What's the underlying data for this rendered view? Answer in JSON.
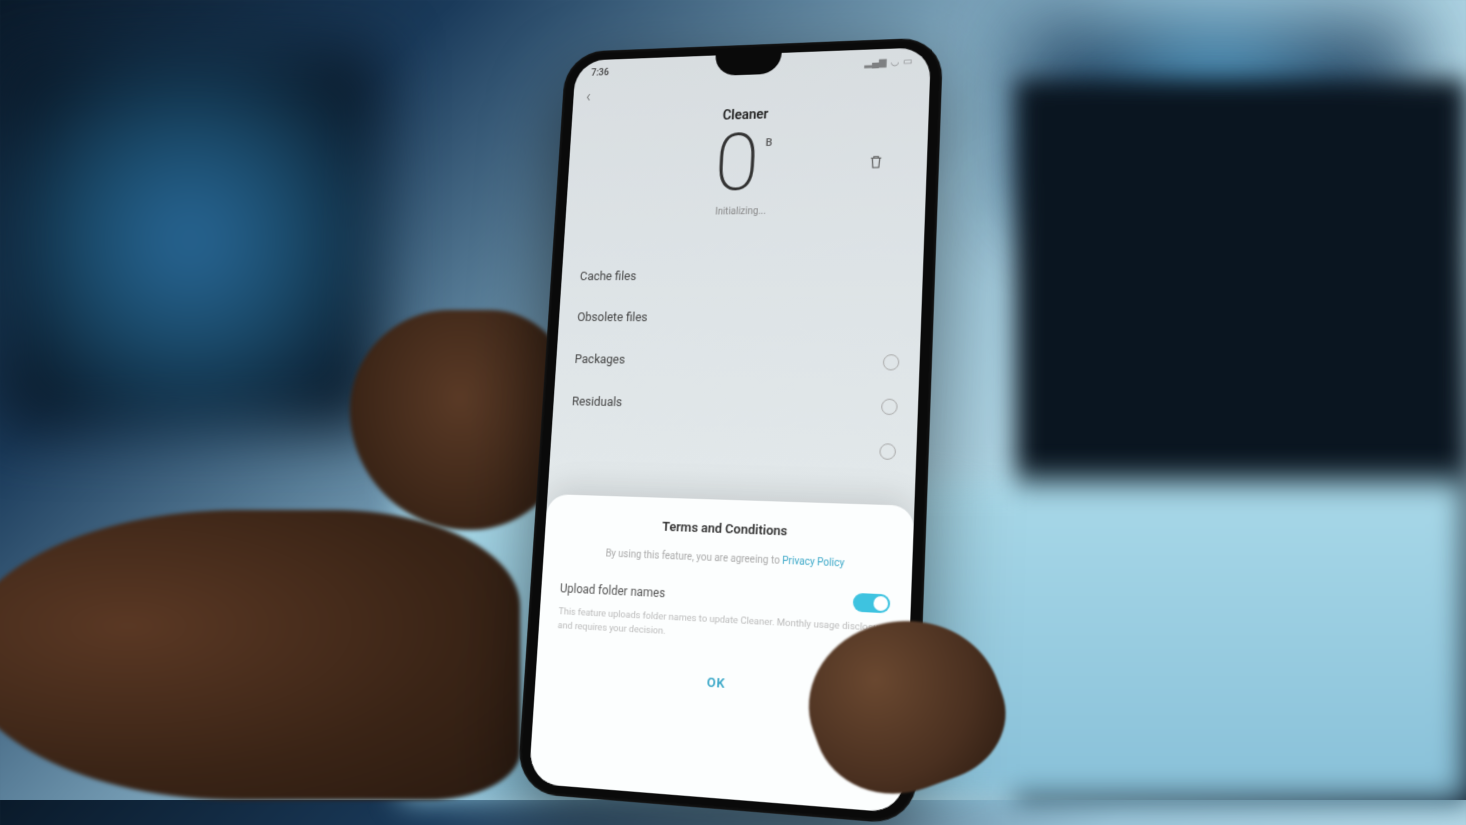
{
  "statusbar": {
    "time": "7:36"
  },
  "header": {
    "title": "Cleaner",
    "size_value": "0",
    "size_unit": "B",
    "status": "Initializing..."
  },
  "list": {
    "items": [
      {
        "label": "Cache files"
      },
      {
        "label": "Obsolete files"
      },
      {
        "label": "Packages"
      },
      {
        "label": "Residuals"
      }
    ]
  },
  "sheet": {
    "title": "Terms and Conditions",
    "subtitle_prefix": "By using this feature, you are agreeing to ",
    "subtitle_link": "Privacy Policy",
    "upload_label": "Upload folder names",
    "upload_desc": "This feature uploads folder names to update Cleaner. Monthly usage disclosure and requires your decision.",
    "ok_label": "OK"
  }
}
